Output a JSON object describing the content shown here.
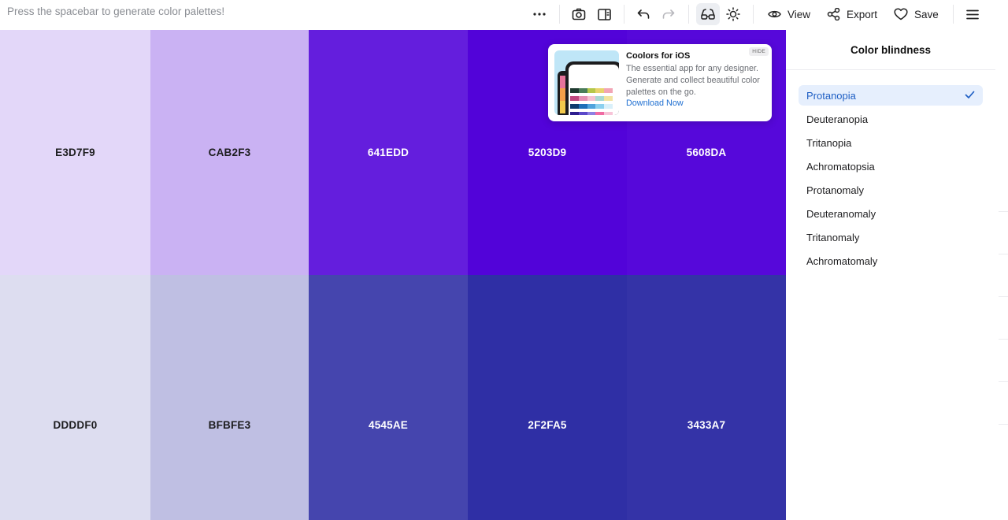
{
  "topbar": {
    "hint": "Press the spacebar to generate color palettes!",
    "icons": [
      "more-icon",
      "camera-icon",
      "sidebar-icon",
      "undo-icon",
      "redo-icon",
      "glasses-icon",
      "sun-icon"
    ],
    "view_label": "View",
    "export_label": "Export",
    "save_label": "Save"
  },
  "palette": {
    "rows": [
      {
        "swatches": [
          {
            "hex": "E3D7F9",
            "color": "#E3D7F9",
            "text_color": "#1d1d1f"
          },
          {
            "hex": "CAB2F3",
            "color": "#CAB2F3",
            "text_color": "#1d1d1f"
          },
          {
            "hex": "641EDD",
            "color": "#641EDD",
            "text_color": "#ffffff"
          },
          {
            "hex": "5203D9",
            "color": "#5203D9",
            "text_color": "#ffffff"
          },
          {
            "hex": "5608DA",
            "color": "#5608DA",
            "text_color": "#ffffff"
          }
        ]
      },
      {
        "swatches": [
          {
            "hex": "DDDDF0",
            "color": "#DDDDF0",
            "text_color": "#1d1d1f"
          },
          {
            "hex": "BFBFE3",
            "color": "#BFBFE3",
            "text_color": "#1d1d1f"
          },
          {
            "hex": "4545AE",
            "color": "#4545AE",
            "text_color": "#ffffff"
          },
          {
            "hex": "2F2FA5",
            "color": "#2F2FA5",
            "text_color": "#ffffff"
          },
          {
            "hex": "3433A7",
            "color": "#3433A7",
            "text_color": "#ffffff"
          }
        ]
      }
    ]
  },
  "ad": {
    "title": "Coolors for iOS",
    "body": "The essential app for any designer. Generate and collect beautiful color palettes on the go.",
    "link": "Download Now",
    "hide_label": "HIDE"
  },
  "panel": {
    "title": "Color blindness",
    "selected_index": 0,
    "options": [
      "Protanopia",
      "Deuteranopia",
      "Tritanopia",
      "Achromatopsia",
      "Protanomaly",
      "Deuteranomaly",
      "Tritanomaly",
      "Achromatomaly"
    ]
  },
  "colors": {
    "accent": "#1f5fc4",
    "selected_bg": "#e6effd",
    "hint_text": "#8a8d93"
  }
}
